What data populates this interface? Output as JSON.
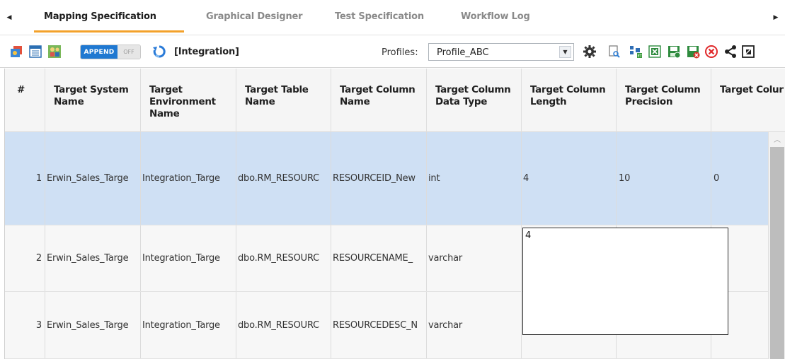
{
  "tabs": [
    {
      "label": "Mapping Specification",
      "active": true
    },
    {
      "label": "Graphical Designer",
      "active": false
    },
    {
      "label": "Test Specification",
      "active": false
    },
    {
      "label": "Workflow Log",
      "active": false
    }
  ],
  "tab_nav": {
    "prev_icon": "caret-left-icon",
    "next_icon": "caret-right-icon"
  },
  "toolbar": {
    "append_toggle": {
      "on_label": "APPEND",
      "off_label": "OFF",
      "state": "on"
    },
    "integration_label": "[Integration]",
    "profiles_label": "Profiles:",
    "profile_value": "Profile_ABC",
    "icons_left": [
      "sync-metadata-icon",
      "view-icon",
      "assign-users-icon",
      "refresh-icon"
    ],
    "icons_right": [
      "settings-gear-icon",
      "search-document-icon",
      "etl-icon",
      "excel-export-icon",
      "save-icon",
      "save-close-icon",
      "cancel-icon",
      "share-icon",
      "expand-icon"
    ]
  },
  "colors": {
    "accent_tab_underline": "#f3a12a",
    "toggle_on": "#1f78d1",
    "selected_row": "#cfe0f4"
  },
  "grid": {
    "columns": [
      "#",
      "Target System Name",
      "Target Environment Name",
      "Target Table Name",
      "Target Column Name",
      "Target Column Data Type",
      "Target Column Length",
      "Target Column Precision",
      "Target Colur Scale"
    ],
    "rows": [
      {
        "num": "1",
        "cells": [
          "Erwin_Sales_Targe",
          "Integration_Targe",
          "dbo.RM_RESOURC",
          "RESOURCEID_New",
          "int",
          "4",
          "10",
          "0"
        ],
        "selected": true
      },
      {
        "num": "2",
        "cells": [
          "Erwin_Sales_Targe",
          "Integration_Targe",
          "dbo.RM_RESOURC",
          "RESOURCENAME_",
          "varchar",
          "",
          "",
          ""
        ],
        "selected": false
      },
      {
        "num": "3",
        "cells": [
          "Erwin_Sales_Targe",
          "Integration_Targe",
          "dbo.RM_RESOURC",
          "RESOURCEDESC_N",
          "varchar",
          "",
          "",
          ""
        ],
        "selected": false
      }
    ],
    "editor_value": "4"
  }
}
